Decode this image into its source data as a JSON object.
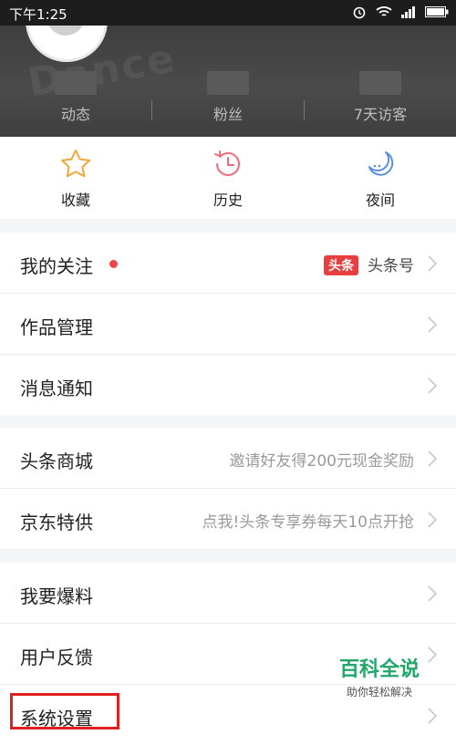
{
  "status_bar": {
    "time": "下午1:25"
  },
  "header": {
    "watermark_text": "Dance",
    "stats": [
      {
        "label": "动态"
      },
      {
        "label": "粉丝"
      },
      {
        "label": "7天访客"
      }
    ]
  },
  "quick_actions": [
    {
      "label": "收藏",
      "icon": "star-icon"
    },
    {
      "label": "历史",
      "icon": "clock-icon"
    },
    {
      "label": "夜间",
      "icon": "moon-icon"
    }
  ],
  "group1": [
    {
      "label": "我的关注",
      "badge": "头条",
      "right": "头条号",
      "has_dot": true
    },
    {
      "label": "作品管理"
    },
    {
      "label": "消息通知"
    }
  ],
  "group2": [
    {
      "label": "头条商城",
      "right": "邀请好友得200元现金奖励"
    },
    {
      "label": "京东特供",
      "right": "点我!头条专享券每天10点开抢"
    }
  ],
  "group3": [
    {
      "label": "我要爆料"
    },
    {
      "label": "用户反馈"
    },
    {
      "label": "系统设置"
    }
  ],
  "watermark": {
    "title": "百科全说",
    "subtitle": "助你轻松解决"
  },
  "colors": {
    "accent_red": "#e73f3f",
    "highlight_red": "#e02020",
    "watermark_green": "#22a66a"
  }
}
